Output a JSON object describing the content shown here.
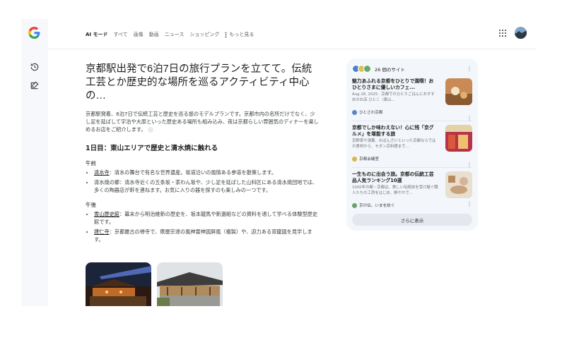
{
  "nav": {
    "tabs": [
      {
        "label": "AI モード",
        "active": true
      },
      {
        "label": "すべて",
        "active": false
      },
      {
        "label": "画像",
        "active": false
      },
      {
        "label": "動画",
        "active": false
      },
      {
        "label": "ニュース",
        "active": false
      },
      {
        "label": "ショッピング",
        "active": false
      }
    ],
    "more_label": "もっと見る"
  },
  "sidebar": {
    "icons": [
      "google-logo",
      "history-icon",
      "new-chat-icon"
    ]
  },
  "answer": {
    "headline": "京都駅出発で6泊7日の旅行プランを立てて。伝統工芸とか歴史的な場所を巡るアクティビティ中心の…",
    "intro": "京都駅発着、6泊7日で伝統工芸と歴史を巡る旅のモデルプランです。京都市内の名所だけでなく、少し足を延ばして宇治や大原といった歴史ある場所も組み込み、夜は京都らしい雰囲気のディナーを楽しめるお店をご紹介します。",
    "day1_heading": "1日目：東山エリアで歴史と清水焼に触れる",
    "morning_label": "午前",
    "morning_items": [
      {
        "name": "清水寺",
        "desc": "：清水の舞台で有名な世界遺産。坂道沿いの風情ある参道を散策します。"
      },
      {
        "name": "清水焼の郷",
        "desc": "：清水寺近くの五条坂・茶わん坂や、少し足を延ばした山科区にある清水焼団地では、多くの陶器店が軒を連ねます。お気に入りの器を探すのも楽しみの一つです。"
      }
    ],
    "afternoon_label": "午後",
    "afternoon_items": [
      {
        "name": "霊山歴史館",
        "desc": "：幕末から明治維新の歴史を、坂本龍馬や新選組などの資料を通して学べる体験型歴史館です。"
      },
      {
        "name": "建仁寺",
        "desc": "：京都最古の禅寺で、俵屋宗達の風神雷神図屏風（複製）や、迫力ある双龍図を見学します。"
      }
    ]
  },
  "sources": {
    "count_label": "26 個のサイト",
    "cards": [
      {
        "title": "魅力あふれる京都をひとりで満喫！おひとりさまに優しいカフェ...",
        "snippet": "Aug 28, 2025 · 京都でのひとりごはんにおすすめのお店 ひとこ（東山...",
        "source": "ひとさわ京都"
      },
      {
        "title": "京都でしか味わえない！心に残「京グルメ」を堪能する旅",
        "snippet": "京野菜や湯葉、おばんざいといった京都ならではの食材から、モダン京料理まで...",
        "source": "京都会議室"
      },
      {
        "title": "一生ものに出会う旅。京都の伝統工芸品人気ランキング10選",
        "snippet": "1000年の都・京都は、美しい伝統技を受け継ぐ職人たちの工房をはじめ、鮮やかで...",
        "source": "京の伝、いまを紡ぐ"
      }
    ],
    "show_more": "さらに表示"
  },
  "colors": {
    "sidebar_bg": "#f6f8fb",
    "panel_bg": "#f3f6fa",
    "text_primary": "#1f1f1f",
    "text_secondary": "#5f6368"
  }
}
